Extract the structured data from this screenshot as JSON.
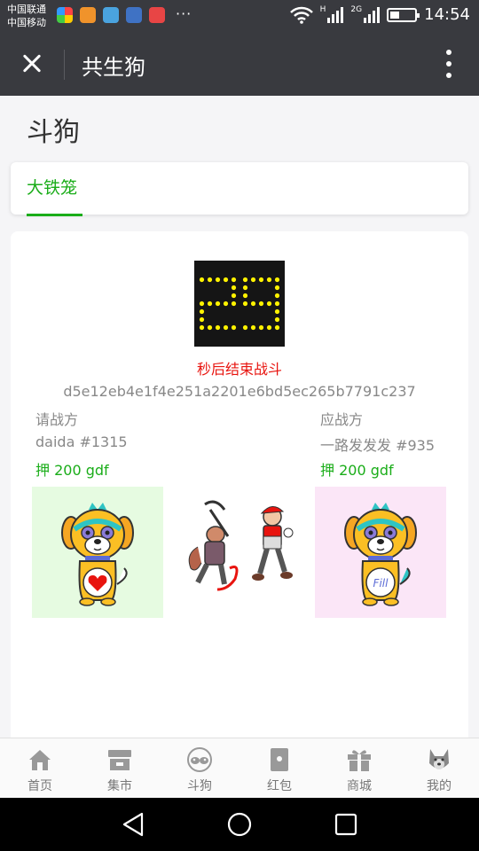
{
  "status_bar": {
    "carrier_1": "中国联通",
    "carrier_2": "中国移动",
    "more": "···",
    "net_1": "H",
    "net_2": "2G",
    "time": "14:54"
  },
  "title_bar": {
    "title": "共生狗"
  },
  "page": {
    "heading": "斗狗",
    "tabs": [
      {
        "label": "大铁笼",
        "active": true
      }
    ]
  },
  "battle": {
    "countdown": "29",
    "end_text": "秒后结束战斗",
    "hash": "d5e12eb4e1f4e251a2201e6bd5ec265b7791c237",
    "challenger": {
      "role": "请战方",
      "name": "daida #1315",
      "bet": "押 200 gdf",
      "bg_color": "#e6fbe1"
    },
    "defender": {
      "role": "应战方",
      "name": "一路发发发 #935",
      "bet": "押 200 gdf",
      "bg_color": "#fbe6f7",
      "shirt_text": "Fill"
    }
  },
  "bottom_nav": {
    "items": [
      {
        "label": "首页",
        "icon": "home-icon"
      },
      {
        "label": "集市",
        "icon": "market-icon"
      },
      {
        "label": "斗狗",
        "icon": "dog-fight-icon"
      },
      {
        "label": "红包",
        "icon": "red-packet-icon"
      },
      {
        "label": "商城",
        "icon": "gift-icon"
      },
      {
        "label": "我的",
        "icon": "dog-avatar-icon"
      }
    ]
  },
  "colors": {
    "accent": "#1aad19",
    "alert": "#e8140f",
    "header": "#393a3f"
  }
}
